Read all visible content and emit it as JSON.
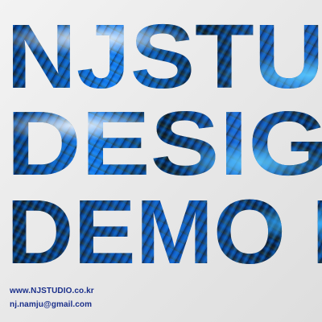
{
  "headline": {
    "line1": "NJSTUDIO",
    "line2": "DESIGN",
    "line3": "DEMO REEL"
  },
  "contact": {
    "website": "www.NJSTUDIO.co.kr",
    "email": "nj.namju@gmail.com"
  },
  "colors": {
    "background": "#eeeeee",
    "text_deep_blue": "#0a2a5c",
    "text_bright_blue": "#1f8bff",
    "contact_text": "#1a2f8a"
  }
}
